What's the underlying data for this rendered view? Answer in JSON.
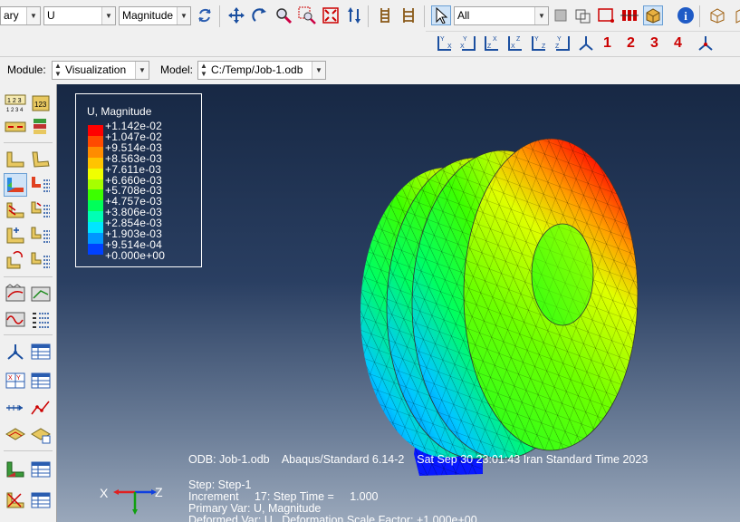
{
  "toolbar": {
    "field_output": {
      "invariant_partial": "ary",
      "variable": "U",
      "invariant": "Magnitude"
    },
    "selection_filter": "All",
    "view_numbers": [
      "1",
      "2",
      "3",
      "4"
    ]
  },
  "context_bar": {
    "module_label": "Module:",
    "module_value": "Visualization",
    "model_label": "Model:",
    "model_value": "C:/Temp/Job-1.odb"
  },
  "legend": {
    "title": "U, Magnitude",
    "entries": [
      "+1.142e-02",
      "+1.047e-02",
      "+9.514e-03",
      "+8.563e-03",
      "+7.611e-03",
      "+6.660e-03",
      "+5.708e-03",
      "+4.757e-03",
      "+3.806e-03",
      "+2.854e-03",
      "+1.903e-03",
      "+9.514e-04",
      "+0.000e+00"
    ],
    "colors": [
      "#ff0000",
      "#ff4a00",
      "#ff8c00",
      "#ffc400",
      "#f0ff00",
      "#a6ff00",
      "#3cff00",
      "#00ff5a",
      "#00ffb4",
      "#00e6ff",
      "#0096ff",
      "#0041ff",
      "#0000ff"
    ]
  },
  "viewport_info": {
    "odb_line": "ODB: Job-1.odb    Abaqus/Standard 6.14-2    Sat Sep 30 23:01:43 Iran Standard Time 2023",
    "step_line": "Step: Step-1",
    "increment_line": "Increment     17: Step Time =     1.000",
    "primary_var_line": "Primary Var: U, Magnitude",
    "deformed_var_line": "Deformed Var: U   Deformation Scale Factor: +1.000e+00"
  },
  "triad": {
    "x": "X",
    "y": "Y",
    "z": "Z"
  }
}
